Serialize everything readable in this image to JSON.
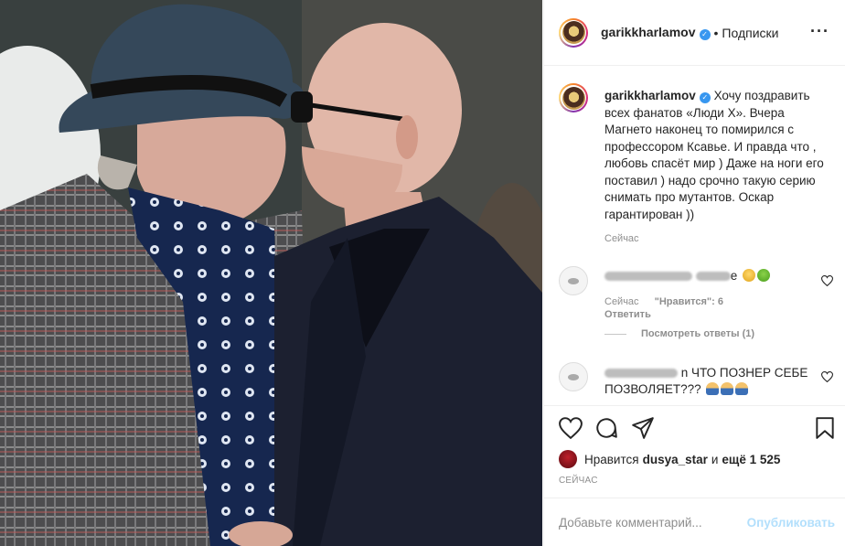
{
  "post": {
    "photo_alt": "Photo",
    "author": "garikkharlamov",
    "separator": "•",
    "follow_label": "Подписки",
    "more_label": "···"
  },
  "caption": {
    "username": "garikkharlamov",
    "text": "Хочу поздравить всех фанатов «Люди Х». Вчера Магнето наконец то помирился с профессором Ксавье. И правда что , любовь спасёт мир ) Даже на ноги его поставил ) надо срочно такую серию снимать про мутантов. Оскар гарантирован ))",
    "time": "Сейчас"
  },
  "comments": [
    {
      "visible_text": "e",
      "time": "Сейчас",
      "likes": "\"Нравится\": 6",
      "reply_label": "Ответить",
      "view_replies": "Посмотреть ответы (1)"
    },
    {
      "visible_text": "n ЧТО ПОЗНЕР СЕБЕ ПОЗВОЛЯЕТ???"
    }
  ],
  "actions": {
    "liked_by_prefix": "Нравится",
    "liked_by_user": "dusya_star",
    "liked_by_and": "и",
    "liked_by_rest": "ещё 1 525",
    "time_caps": "СЕЙЧАС",
    "comment_placeholder": "Добавьте комментарий...",
    "publish_label": "Опубликовать"
  },
  "icons": [
    "heart-icon",
    "comment-icon",
    "share-icon",
    "bookmark-icon",
    "verified-icon",
    "more-icon"
  ],
  "colors": {
    "accent": "#3897f0",
    "publish_disabled": "#b2dffc",
    "muted": "#8e8e8e"
  }
}
